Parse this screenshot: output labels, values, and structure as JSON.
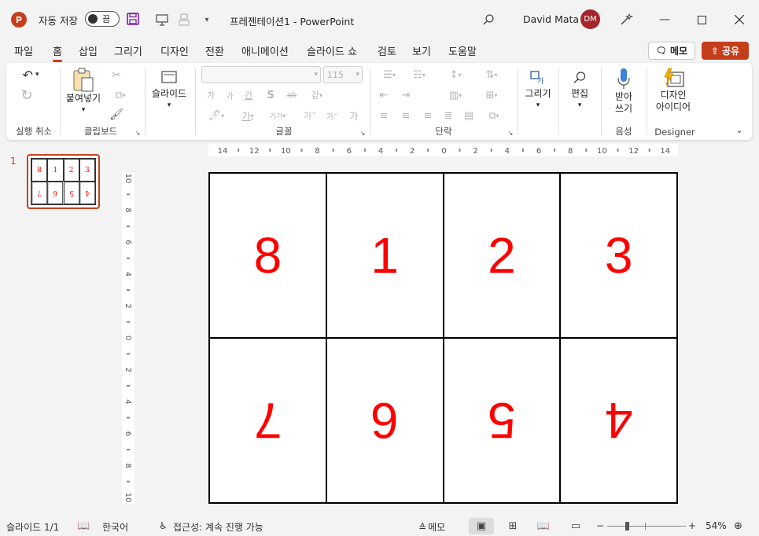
{
  "titlebar": {
    "autosave_label": "자동 저장",
    "toggle_label": "끔",
    "doc_title": "프레젠테이션1  -  PowerPoint",
    "user_name": "David Mata",
    "avatar_initials": "DM",
    "app_logo": "P"
  },
  "tabs": [
    "파일",
    "홈",
    "삽입",
    "그리기",
    "디자인",
    "전환",
    "애니메이션",
    "슬라이드 쇼",
    "검토",
    "보기",
    "도움말"
  ],
  "active_tab": "홈",
  "header_buttons": {
    "memo": "메모",
    "share": "공유"
  },
  "ribbon": {
    "groups": {
      "undo": "실행 취소",
      "clipboard": "클립보드",
      "font": "글꼴",
      "paragraph": "단락",
      "voice": "음성",
      "designer": "Designer"
    },
    "paste_label": "붙여넣기",
    "slide_label": "슬라이드",
    "draw_label": "그리기",
    "edit_label": "편집",
    "dictate_label_1": "받아",
    "dictate_label_2": "쓰기",
    "designer_label_1": "디자인",
    "designer_label_2": "아이디어",
    "font_size": "115"
  },
  "thumbnail": {
    "number": "1",
    "top_row": [
      "8",
      "1",
      "2",
      "3"
    ],
    "bottom_row": [
      "7",
      "6",
      "5",
      "4"
    ]
  },
  "slide": {
    "top_row": [
      "8",
      "1",
      "2",
      "3"
    ],
    "bottom_row": [
      "7",
      "6",
      "5",
      "4"
    ]
  },
  "ruler": {
    "horizontal": [
      "14",
      "12",
      "10",
      "8",
      "6",
      "4",
      "2",
      "0",
      "2",
      "4",
      "6",
      "8",
      "10",
      "12",
      "14"
    ],
    "vertical": [
      "10",
      "8",
      "6",
      "4",
      "2",
      "0",
      "2",
      "4",
      "6",
      "8",
      "10"
    ]
  },
  "status": {
    "slide_count": "슬라이드 1/1",
    "language": "한국어",
    "accessibility": "접근성: 계속 진행 가능",
    "notes": "메모",
    "zoom": "54%"
  },
  "colors": {
    "accent": "#c43e1c",
    "slide_numbers": "#ff0000"
  }
}
